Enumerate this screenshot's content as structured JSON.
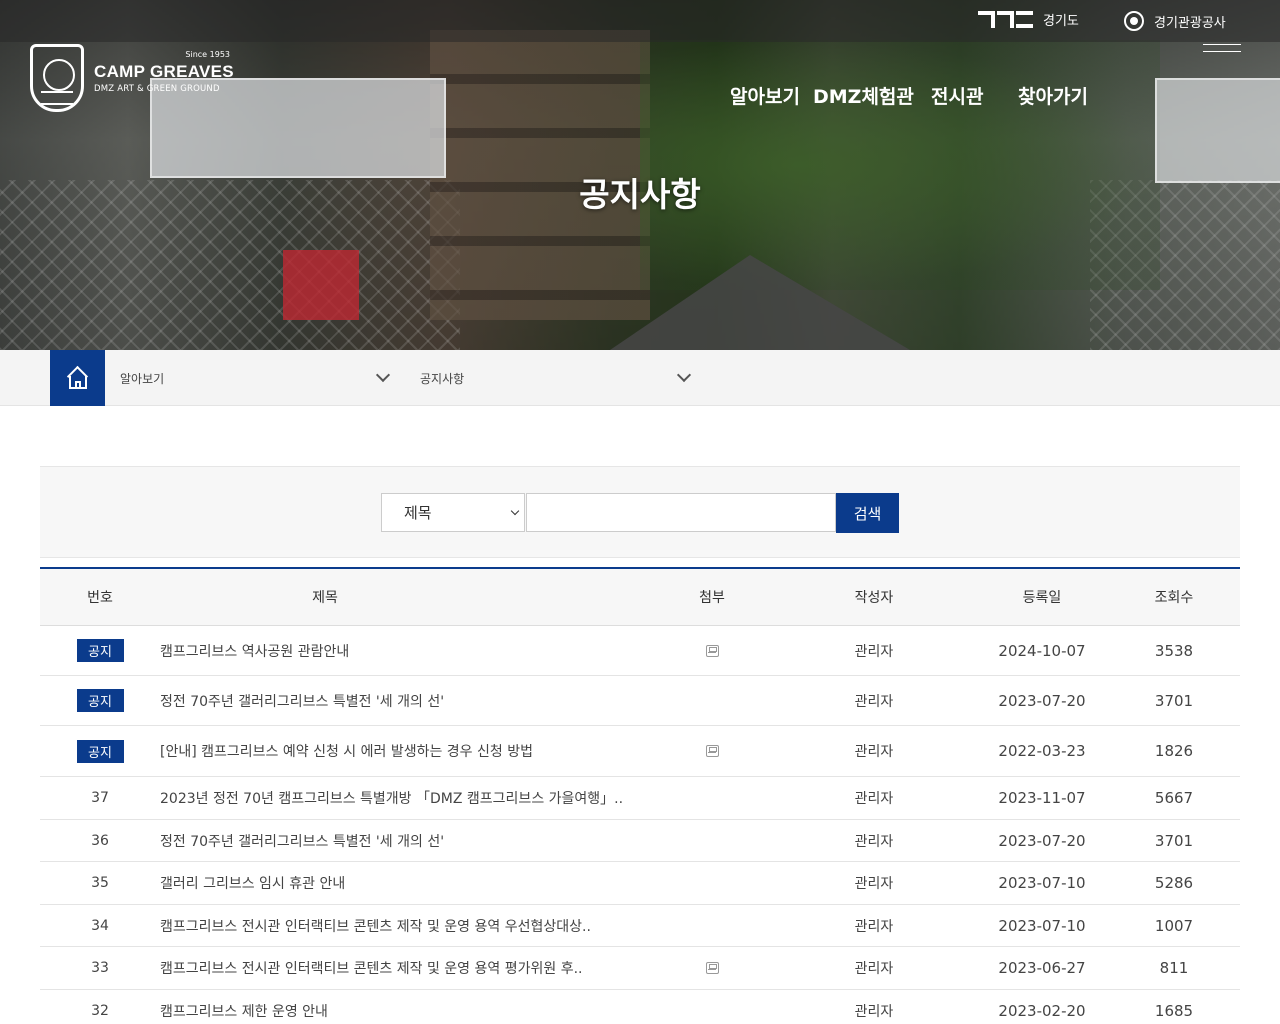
{
  "top": {
    "gyeonggi_label": "경기도",
    "gto_label": "경기관광공사"
  },
  "logo": {
    "since": "Since 1953",
    "name": "CAMP GREAVES",
    "sub": "DMZ  ART & GREEN GROUND"
  },
  "gnb": [
    "알아보기",
    "DMZ체험관",
    "전시관",
    "찾아가기"
  ],
  "hero": {
    "title": "공지사항"
  },
  "breadcrumb": {
    "level1": "알아보기",
    "level2": "공지사항"
  },
  "search": {
    "field_selected": "제목",
    "input_value": "",
    "button_label": "검색"
  },
  "board": {
    "headers": {
      "no": "번호",
      "title": "제목",
      "attach": "첨부",
      "author": "작성자",
      "date": "등록일",
      "views": "조회수"
    },
    "rows": [
      {
        "no": "공지",
        "notice": true,
        "title": "캠프그리브스 역사공원 관람안내",
        "attach": true,
        "author": "관리자",
        "date": "2024-10-07",
        "views": "3538"
      },
      {
        "no": "공지",
        "notice": true,
        "title": "정전 70주년 갤러리그리브스 특별전 '세 개의 선'",
        "attach": false,
        "author": "관리자",
        "date": "2023-07-20",
        "views": "3701"
      },
      {
        "no": "공지",
        "notice": true,
        "title": "[안내] 캠프그리브스 예약 신청 시 에러 발생하는 경우 신청 방법",
        "attach": true,
        "author": "관리자",
        "date": "2022-03-23",
        "views": "1826"
      },
      {
        "no": "37",
        "notice": false,
        "title": "2023년 정전 70년 캠프그리브스 특별개방 「DMZ 캠프그리브스 가을여행」..",
        "attach": false,
        "author": "관리자",
        "date": "2023-11-07",
        "views": "5667"
      },
      {
        "no": "36",
        "notice": false,
        "title": "정전 70주년 갤러리그리브스 특별전 '세 개의 선'",
        "attach": false,
        "author": "관리자",
        "date": "2023-07-20",
        "views": "3701"
      },
      {
        "no": "35",
        "notice": false,
        "title": "갤러리 그리브스 임시 휴관 안내",
        "attach": false,
        "author": "관리자",
        "date": "2023-07-10",
        "views": "5286"
      },
      {
        "no": "34",
        "notice": false,
        "title": "캠프그리브스 전시관 인터랙티브 콘텐츠 제작 및 운영 용역 우선협상대상..",
        "attach": false,
        "author": "관리자",
        "date": "2023-07-10",
        "views": "1007"
      },
      {
        "no": "33",
        "notice": false,
        "title": "캠프그리브스 전시관 인터랙티브 콘텐츠 제작 및 운영 용역 평가위원 후..",
        "attach": true,
        "author": "관리자",
        "date": "2023-06-27",
        "views": "811"
      },
      {
        "no": "32",
        "notice": false,
        "title": "캠프그리브스 제한 운영 안내",
        "attach": false,
        "author": "관리자",
        "date": "2023-02-20",
        "views": "1685"
      }
    ]
  },
  "colors": {
    "primary": "#0b3b8c"
  }
}
